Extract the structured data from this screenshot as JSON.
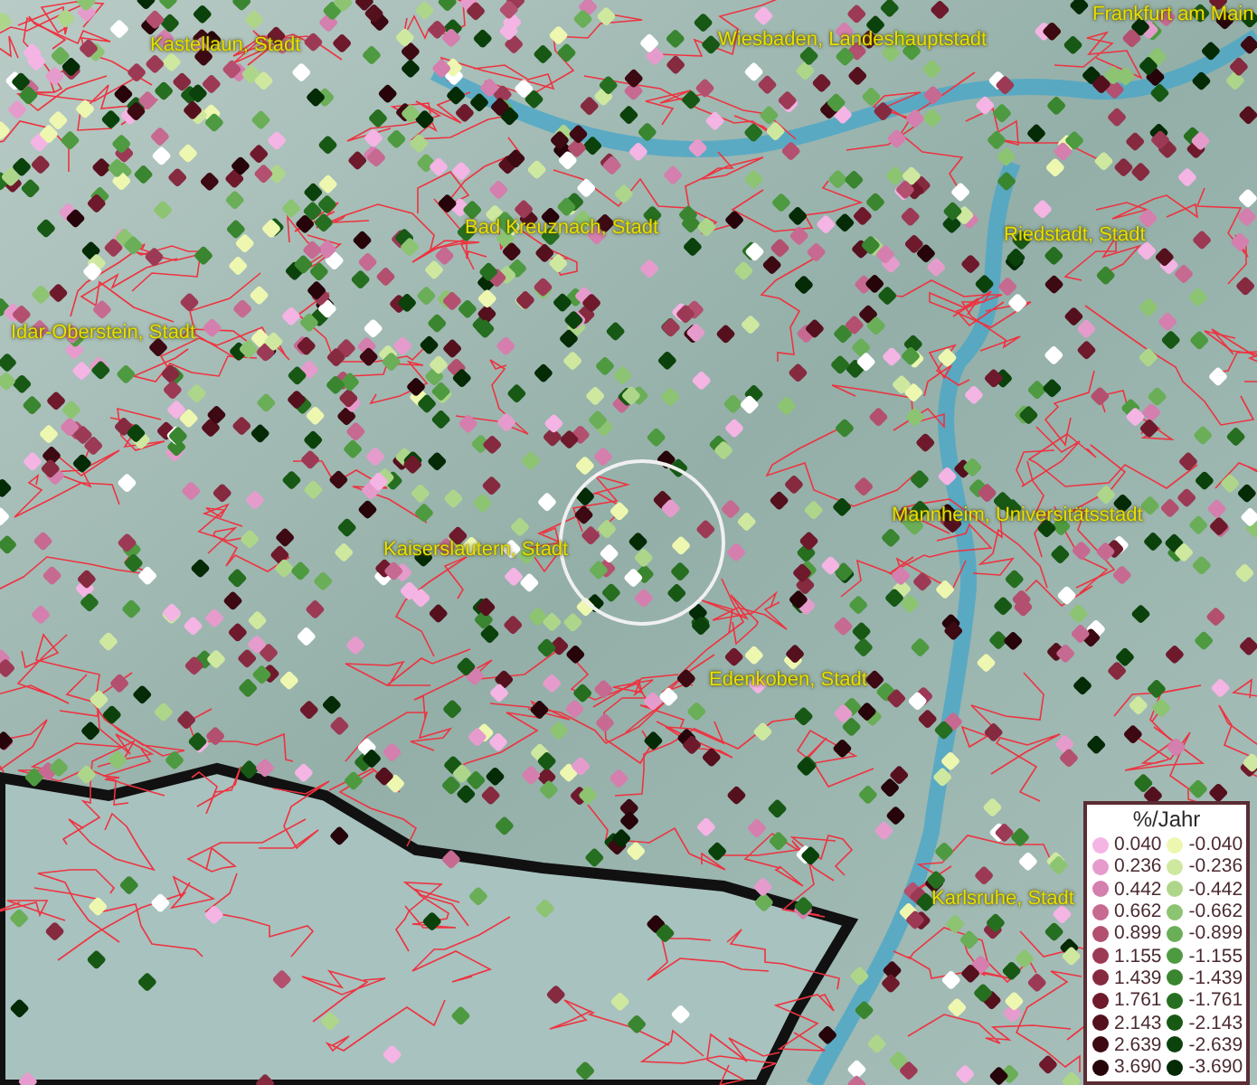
{
  "map": {
    "places": [
      {
        "name": "Kastellaun, Stadt"
      },
      {
        "name": "Wiesbaden, Landeshauptstadt"
      },
      {
        "name": "Frankfurt am Main"
      },
      {
        "name": "Bad Kreuznach, Stadt"
      },
      {
        "name": "Riedstadt, Stadt"
      },
      {
        "name": "Idar-Oberstein, Stadt"
      },
      {
        "name": "Kaiserslautern, Stadt"
      },
      {
        "name": "Mannheim, Universitätsstadt"
      },
      {
        "name": "Edenkoben, Stadt"
      },
      {
        "name": "Karlsruhe, Stadt"
      }
    ]
  },
  "legend": {
    "title": "%/Jahr",
    "positive": [
      {
        "label": "0.040",
        "color": "#f4b4e4"
      },
      {
        "label": "0.236",
        "color": "#e59ccc"
      },
      {
        "label": "0.442",
        "color": "#d47fae"
      },
      {
        "label": "0.662",
        "color": "#c66a92"
      },
      {
        "label": "0.899",
        "color": "#b3506f"
      },
      {
        "label": "1.155",
        "color": "#9c3a55"
      },
      {
        "label": "1.439",
        "color": "#862a40"
      },
      {
        "label": "1.761",
        "color": "#6e1a2c"
      },
      {
        "label": "2.143",
        "color": "#55101e"
      },
      {
        "label": "2.639",
        "color": "#3d0912"
      },
      {
        "label": "3.690",
        "color": "#26040a"
      }
    ],
    "negative": [
      {
        "label": "-0.040",
        "color": "#eef7b0"
      },
      {
        "label": "-0.236",
        "color": "#cfe8a0"
      },
      {
        "label": "-0.442",
        "color": "#aed68a"
      },
      {
        "label": "-0.662",
        "color": "#8cc472"
      },
      {
        "label": "-0.899",
        "color": "#6aae58"
      },
      {
        "label": "-1.155",
        "color": "#4e9a40"
      },
      {
        "label": "-1.439",
        "color": "#3a852f"
      },
      {
        "label": "-1.761",
        "color": "#266e20"
      },
      {
        "label": "-2.143",
        "color": "#175815"
      },
      {
        "label": "-2.639",
        "color": "#0b420c"
      },
      {
        "label": "-3.690",
        "color": "#042a06"
      }
    ]
  }
}
